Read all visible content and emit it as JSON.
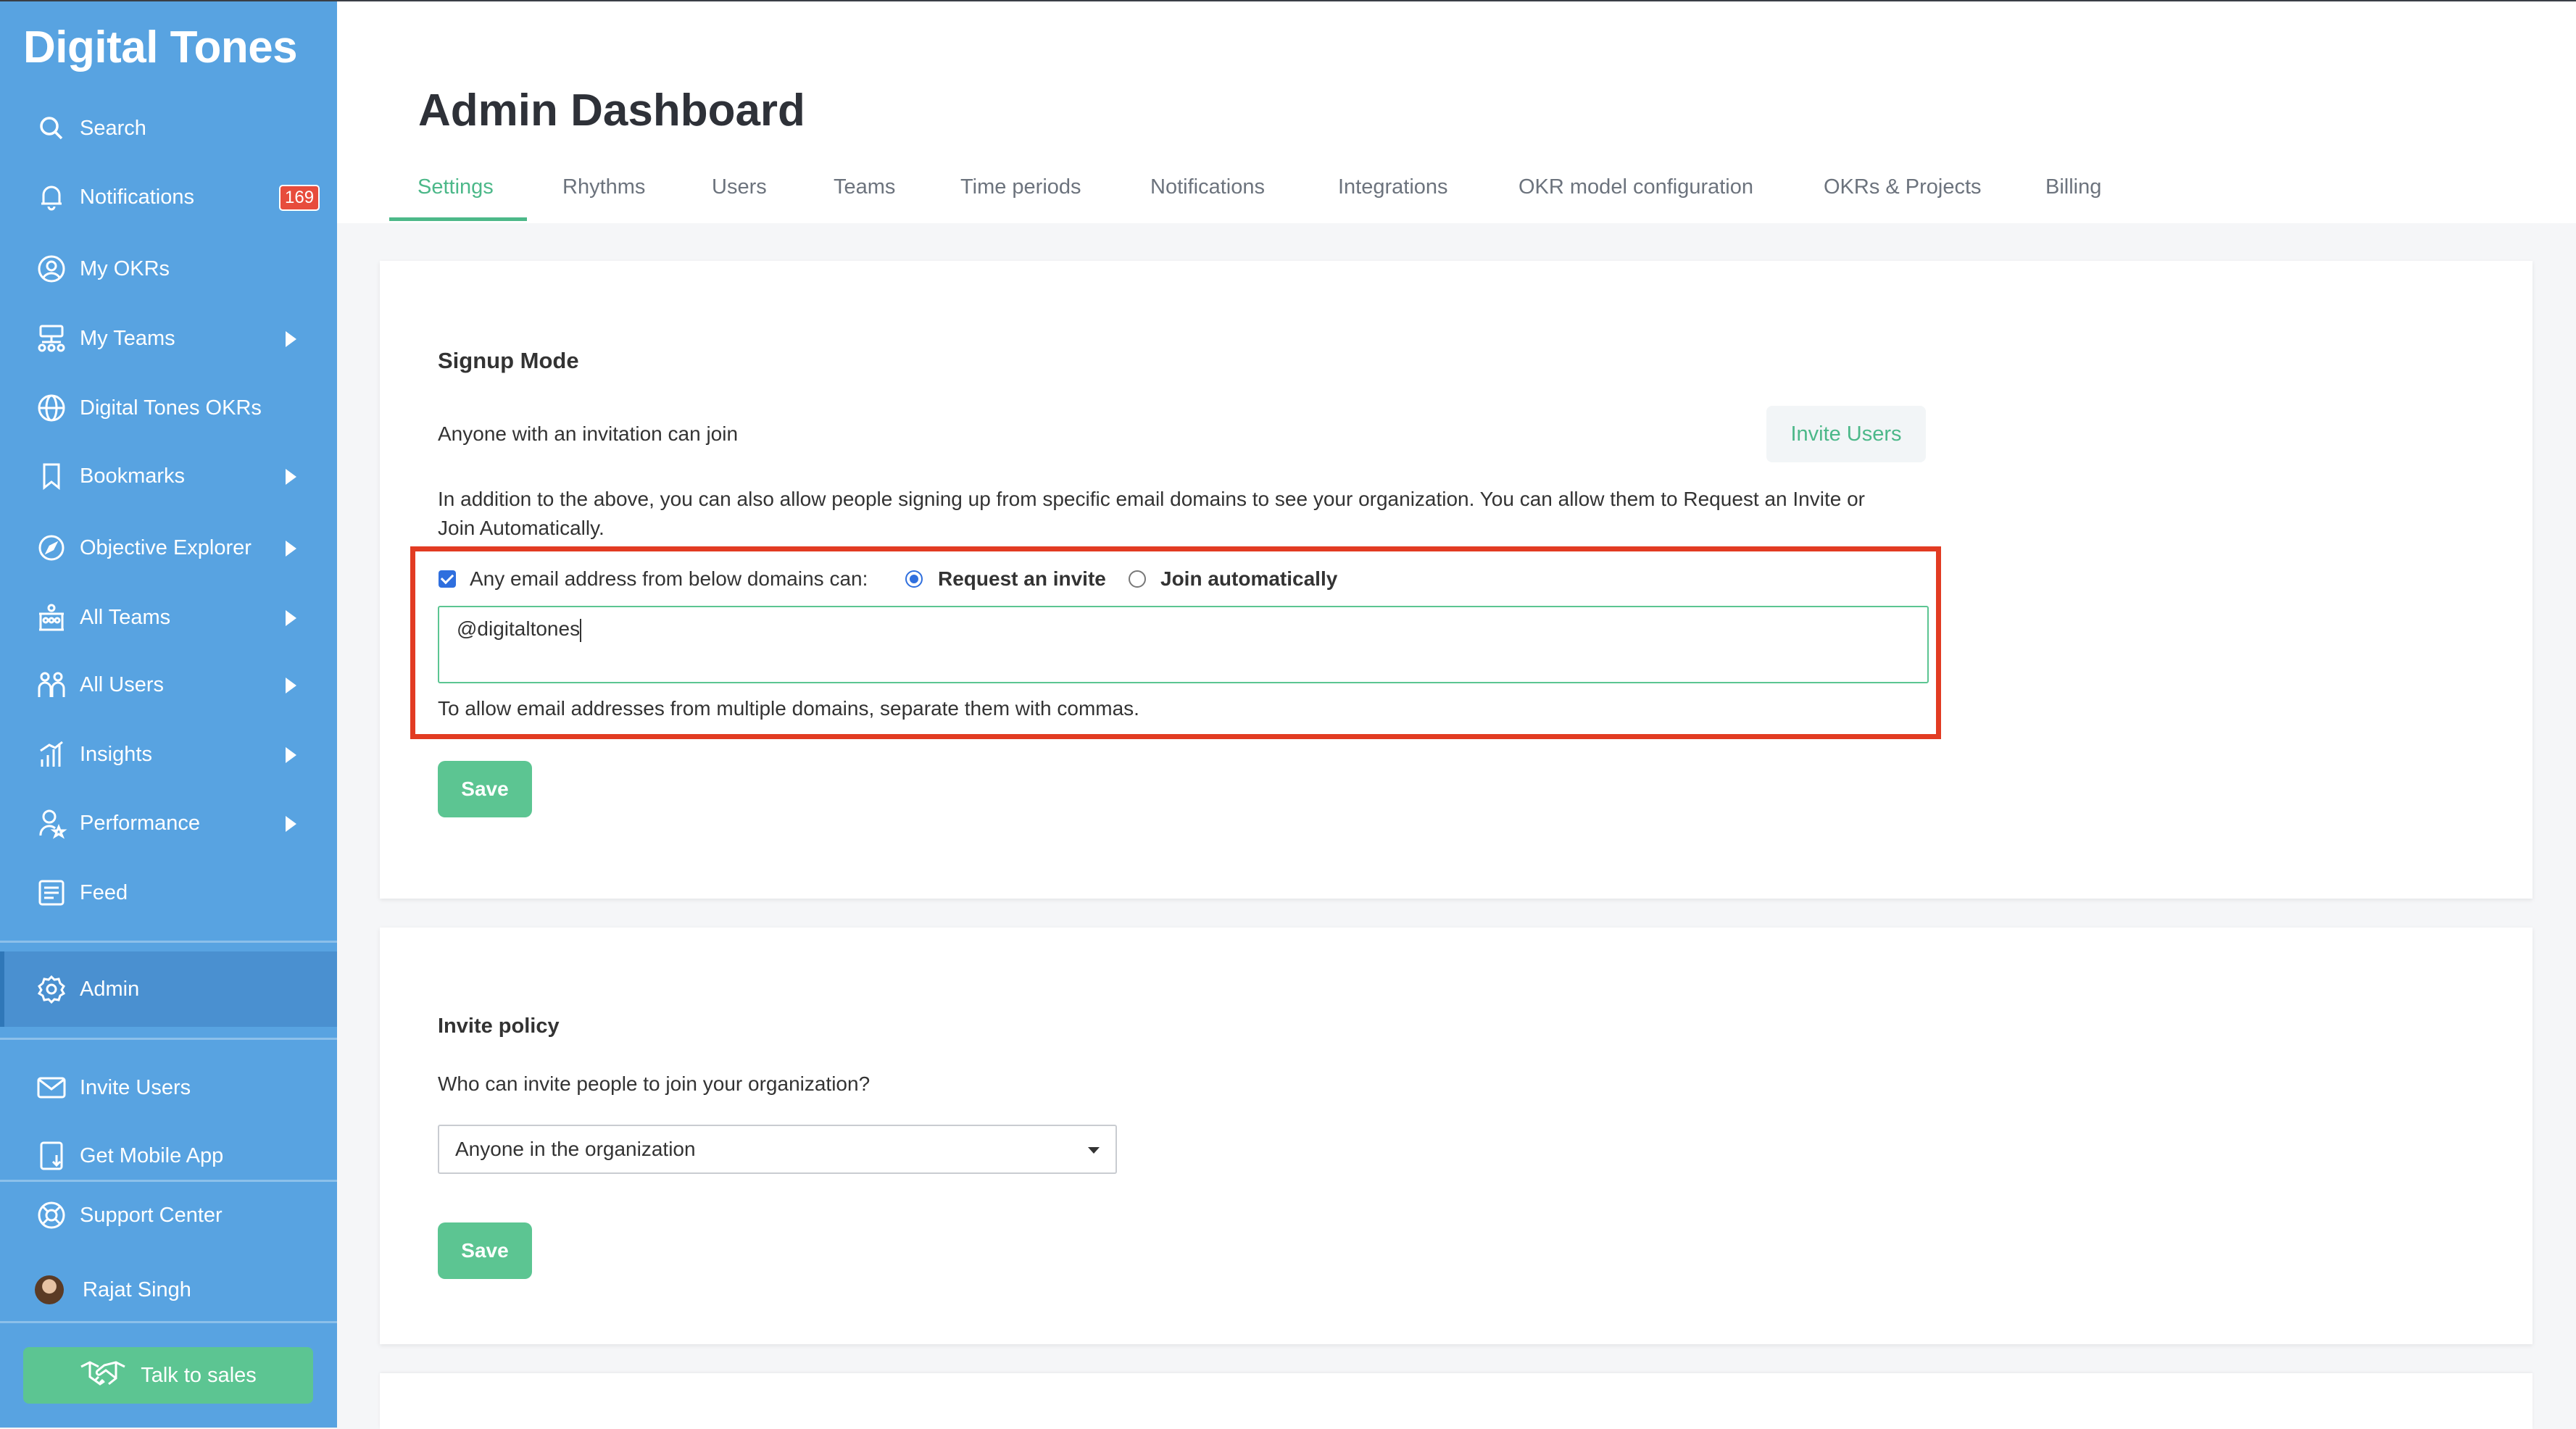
{
  "sidebar": {
    "brand": "Digital Tones",
    "items": [
      {
        "label": "Search",
        "icon": "search-icon"
      },
      {
        "label": "Notifications",
        "icon": "bell-icon",
        "badge": "169"
      },
      {
        "label": "My OKRs",
        "icon": "user-circle-icon"
      },
      {
        "label": "My Teams",
        "icon": "org-chart-icon"
      },
      {
        "label": "Digital Tones OKRs",
        "icon": "globe-icon"
      },
      {
        "label": "Bookmarks",
        "icon": "bookmark-icon"
      },
      {
        "label": "Objective Explorer",
        "icon": "compass-icon"
      },
      {
        "label": "All Teams",
        "icon": "teams-icon"
      },
      {
        "label": "All Users",
        "icon": "users-icon"
      },
      {
        "label": "Insights",
        "icon": "bar-chart-icon"
      },
      {
        "label": "Performance",
        "icon": "award-icon"
      },
      {
        "label": "Feed",
        "icon": "feed-icon"
      },
      {
        "label": "Admin",
        "icon": "gear-icon"
      },
      {
        "label": "Invite Users",
        "icon": "mail-icon"
      },
      {
        "label": "Get Mobile App",
        "icon": "mobile-download-icon"
      },
      {
        "label": "Support Center",
        "icon": "lifebuoy-icon"
      },
      {
        "label": "Rajat Singh",
        "icon": "avatar"
      }
    ],
    "talk_to_sales": "Talk to sales"
  },
  "header": {
    "title": "Admin Dashboard",
    "tabs": [
      {
        "label": "Settings"
      },
      {
        "label": "Rhythms"
      },
      {
        "label": "Users"
      },
      {
        "label": "Teams"
      },
      {
        "label": "Time periods"
      },
      {
        "label": "Notifications"
      },
      {
        "label": "Integrations"
      },
      {
        "label": "OKR model configuration"
      },
      {
        "label": "OKRs & Projects"
      },
      {
        "label": "Billing"
      }
    ],
    "active_tab": "Settings"
  },
  "signup": {
    "heading": "Signup Mode",
    "invitation_text": "Anyone with an invitation can join",
    "invite_button": "Invite Users",
    "description_line1": "In addition to the above, you can also allow people signing up from specific email domains to see your organization. You can allow them to Request an Invite or",
    "description_line2": "Join Automatically.",
    "domain_checkbox_label": "Any email address from below domains can:",
    "domain_checkbox_checked": true,
    "radio_request": "Request an invite",
    "radio_join": "Join automatically",
    "selected_option": "Request an invite",
    "domains_value": "@digitaltones",
    "help_text": "To allow email addresses from multiple domains, separate them with commas.",
    "save_label": "Save"
  },
  "invite_policy": {
    "heading": "Invite policy",
    "question": "Who can invite people to join your organization?",
    "selected": "Anyone in the organization",
    "save_label": "Save"
  },
  "colors": {
    "sidebar": "#58a3e1",
    "accent_green": "#5cc592",
    "highlight_red": "#e23b22",
    "badge_red": "#e74c3c"
  }
}
